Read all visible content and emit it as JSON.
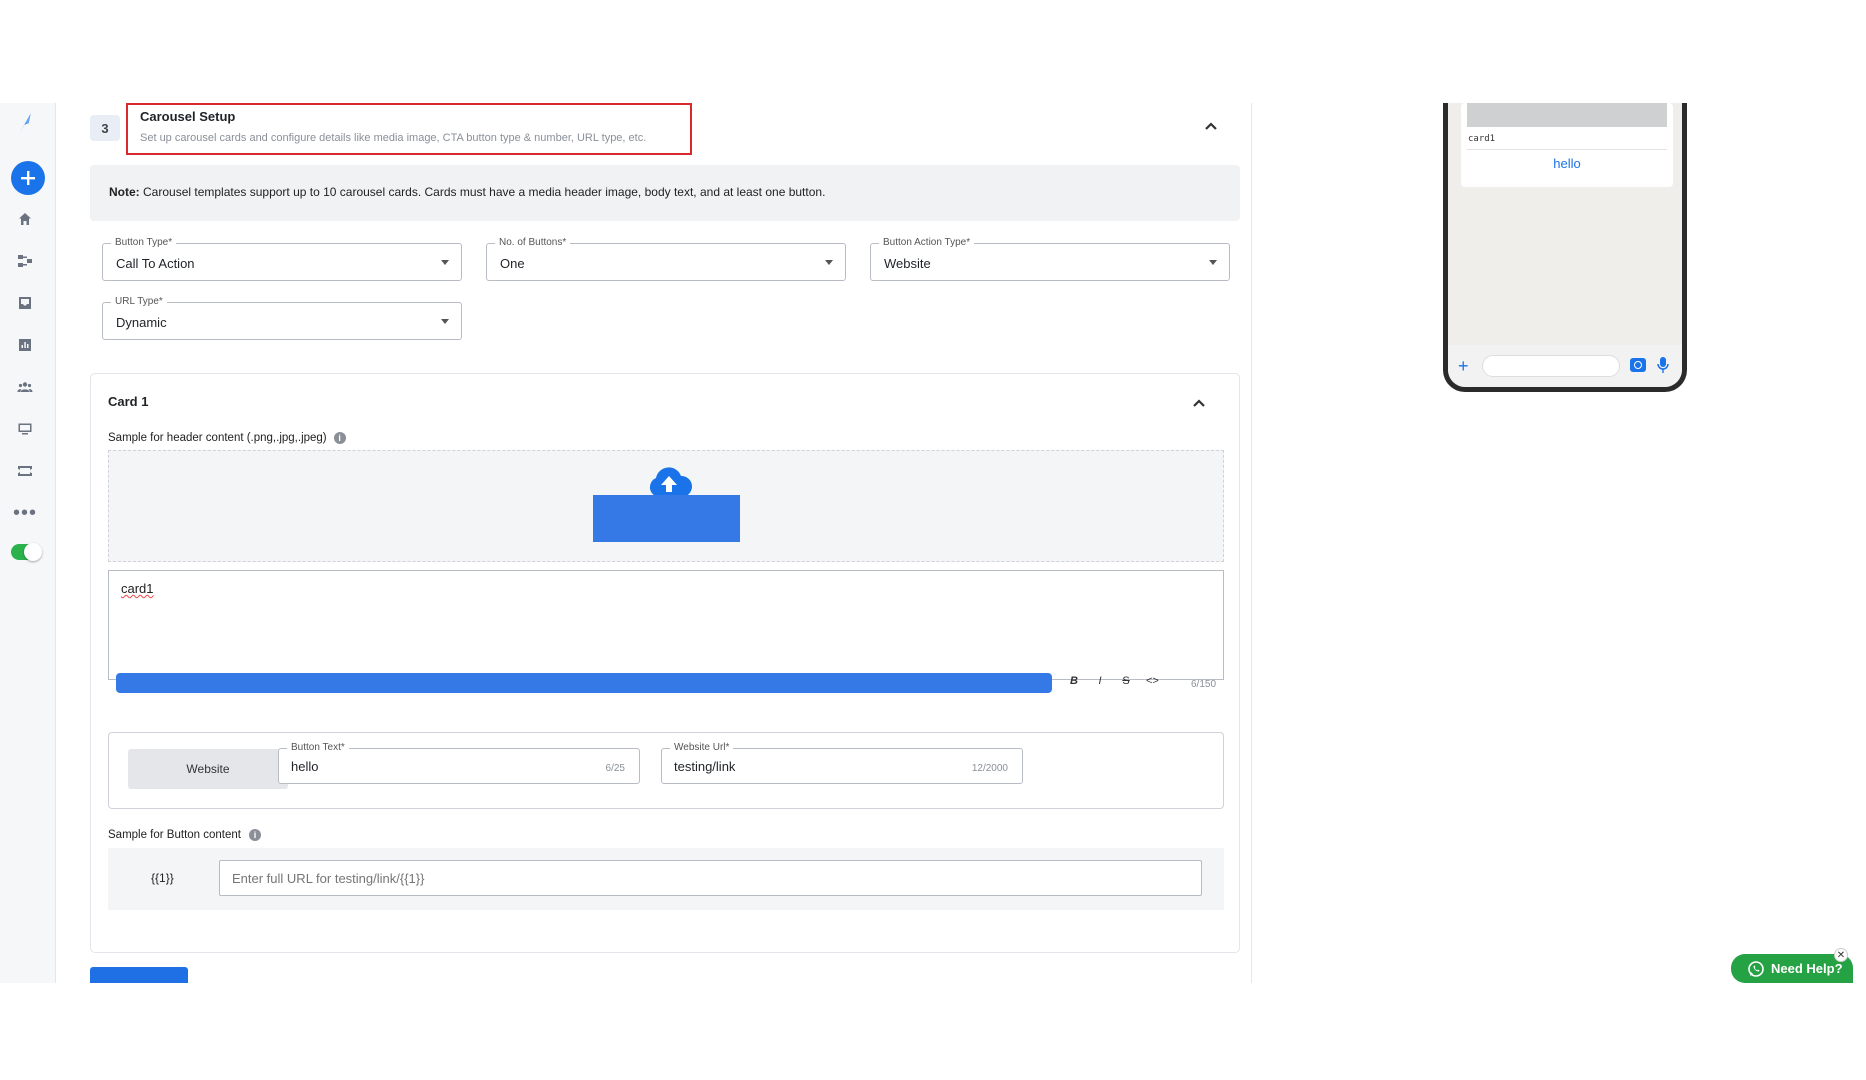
{
  "step": {
    "number": "3",
    "title": "Carousel Setup",
    "subtitle": "Set up carousel cards and configure details like media image, CTA button type & number, URL type, etc."
  },
  "note": {
    "prefix": "Note:",
    "text": " Carousel templates support up to 10 carousel cards. Cards must have a media header image, body text, and at least one button."
  },
  "selects": {
    "button_type": {
      "label": "Button Type*",
      "value": "Call To Action"
    },
    "num_buttons": {
      "label": "No. of Buttons*",
      "value": "One"
    },
    "action_type": {
      "label": "Button Action Type*",
      "value": "Website"
    },
    "url_type": {
      "label": "URL Type*",
      "value": "Dynamic"
    }
  },
  "card": {
    "title": "Card 1",
    "header_label": "Sample for header content (.png,.jpg,.jpeg)",
    "body_text": "card1",
    "body_counter": "6/150",
    "toolbar": {
      "bold": "B",
      "italic": "I",
      "strike": "S",
      "code": "<>"
    },
    "button_chip": "Website",
    "button_text": {
      "label": "Button Text*",
      "value": "hello",
      "counter": "6/25"
    },
    "website_url": {
      "label": "Website Url*",
      "value": "testing/link",
      "counter": "12/2000"
    },
    "sample_button_label": "Sample for Button content",
    "variable": "{{1}}",
    "url_placeholder": "Enter full URL for testing/link/{{1}}"
  },
  "preview": {
    "card_text": "card1",
    "button_text": "hello"
  },
  "help": {
    "label": "Need Help?",
    "close": "✕"
  },
  "colors": {
    "primary": "#1a73e8",
    "highlight_border": "#d8292f",
    "help_green": "#25a244"
  }
}
